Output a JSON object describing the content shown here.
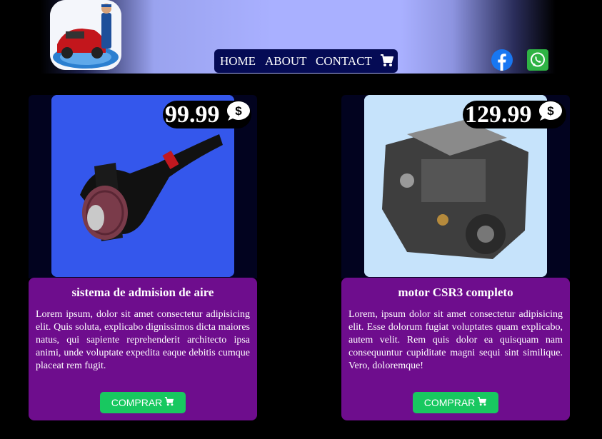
{
  "nav": {
    "home": "HOME",
    "about": "ABOUT",
    "contact": "CONTACT",
    "cart_icon": "cart-icon"
  },
  "social": {
    "facebook_icon": "facebook-icon",
    "whatsapp_icon": "whatsapp-icon"
  },
  "colors": {
    "nav_bg": "#050b55",
    "card_body": "#6e0d8d",
    "buy_button": "#18c860",
    "header_center": "#a9b0ff"
  },
  "products": [
    {
      "price": "99.99",
      "currency_icon": "dollar-chat-icon",
      "title": "sistema de admision de aire",
      "description": "Lorem ipsum, dolor sit amet consectetur adipisicing elit. Quis soluta, explicabo dignissimos dicta maiores natus, qui sapiente reprehenderit architecto ipsa animi, unde voluptate expedita eaque debitis cumque placeat rem fugit.",
      "button": "COMPRAR"
    },
    {
      "price": "129.99",
      "currency_icon": "dollar-chat-icon",
      "title": "motor CSR3 completo",
      "description": "Lorem, ipsum dolor sit amet consectetur adipisicing elit. Esse dolorum fugiat voluptates quam explicabo, autem velit. Rem quis dolor ea quisquam nam consequuntur cupiditate magni sequi sint similique. Vero, doloremque!",
      "button": "COMPRAR"
    }
  ]
}
